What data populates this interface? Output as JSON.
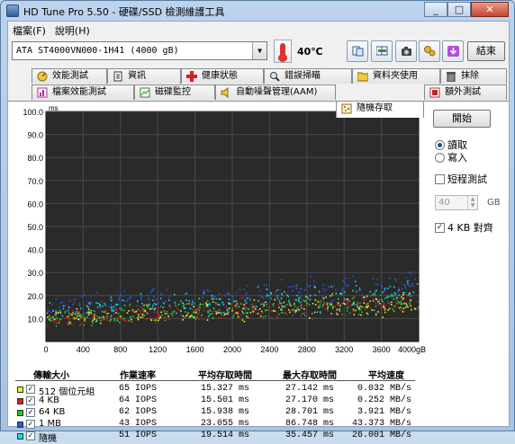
{
  "window": {
    "title": "HD Tune Pro 5.50 - 硬碟/SSD 檢測維護工具"
  },
  "menu": [
    {
      "label": "檔案(F)"
    },
    {
      "label": "說明(H)"
    }
  ],
  "toolbar": {
    "drive": "ATA   ST4000VN000-1H41 (4000 gB)",
    "temperature": "40℃",
    "exit_label": "結束"
  },
  "tabs_row1": [
    {
      "label": "效能測試",
      "icon": "gauge-icon"
    },
    {
      "label": "資訊",
      "icon": "info-icon"
    },
    {
      "label": "健康狀態",
      "icon": "health-cross-icon"
    },
    {
      "label": "錯誤掃瞄",
      "icon": "magnifier-icon"
    },
    {
      "label": "資料夾使用",
      "icon": "folder-icon"
    },
    {
      "label": "抹除",
      "icon": "trash-icon"
    }
  ],
  "tabs_row2": [
    {
      "label": "檔案效能測試",
      "icon": "file-benchmark-icon"
    },
    {
      "label": "磁碟監控",
      "icon": "monitor-icon"
    },
    {
      "label": "自動噪聲管理(AAM)",
      "icon": "speaker-icon"
    },
    {
      "label": "隨機存取",
      "icon": "random-access-icon",
      "active": true
    },
    {
      "label": "額外測試",
      "icon": "extra-tests-icon"
    }
  ],
  "side": {
    "start_label": "開始",
    "mode_read": "讀取",
    "mode_write": "寫入",
    "mode_selected": "read",
    "short_stroke_label": "短程測試",
    "short_stroke_checked": false,
    "short_stroke_value": "40",
    "short_stroke_unit": "GB",
    "align_label": "4 KB 對齊",
    "align_checked": true
  },
  "results": {
    "headers": [
      "傳輸大小",
      "作業速率",
      "平均存取時間",
      "最大存取時間",
      "平均速度"
    ],
    "rows": [
      {
        "name": "512 個位元組",
        "color": "#f5e82a",
        "iops": "65 IOPS",
        "avg": "15.327 ms",
        "max": "27.142 ms",
        "speed": "0.032 MB/s"
      },
      {
        "name": "4 KB",
        "color": "#d42020",
        "iops": "64 IOPS",
        "avg": "15.501 ms",
        "max": "27.170 ms",
        "speed": "0.252 MB/s"
      },
      {
        "name": "64 KB",
        "color": "#26c426",
        "iops": "62 IOPS",
        "avg": "15.938 ms",
        "max": "28.701 ms",
        "speed": "3.921 MB/s"
      },
      {
        "name": "1 MB",
        "color": "#2a56d8",
        "iops": "43 IOPS",
        "avg": "23.055 ms",
        "max": "86.748 ms",
        "speed": "43.373 MB/s"
      },
      {
        "name": "隨機",
        "color": "#1fd8e0",
        "iops": "51 IOPS",
        "avg": "19.514 ms",
        "max": "35.457 ms",
        "speed": "26.001 MB/s"
      }
    ]
  },
  "chart_data": {
    "type": "scatter",
    "ylabel": "ms",
    "ylim": [
      0,
      100
    ],
    "xlim": [
      0,
      4000
    ],
    "x_unit": "gB",
    "y_ticks": [
      "100.0",
      "90.0",
      "80.0",
      "70.0",
      "60.0",
      "50.0",
      "40.0",
      "30.0",
      "20.0",
      "10.0"
    ],
    "x_ticks": [
      "0",
      "400",
      "800",
      "1200",
      "1600",
      "2000",
      "2400",
      "2800",
      "3200",
      "3600",
      "4000gB"
    ],
    "grid": true,
    "background": "#2a2a2a",
    "series": [
      {
        "name": "512 個位元組",
        "color": "#f5e82a",
        "band": [
          [
            0,
            5,
            15
          ],
          [
            4000,
            9,
            25
          ]
        ]
      },
      {
        "name": "4 KB",
        "color": "#d42020",
        "band": [
          [
            0,
            5,
            15
          ],
          [
            4000,
            9,
            25
          ]
        ]
      },
      {
        "name": "64 KB",
        "color": "#26c426",
        "band": [
          [
            0,
            5,
            16
          ],
          [
            4000,
            10,
            26
          ]
        ]
      },
      {
        "name": "1 MB",
        "color": "#2a56d8",
        "band": [
          [
            0,
            10,
            22
          ],
          [
            4000,
            16,
            34
          ]
        ]
      },
      {
        "name": "隨機",
        "color": "#1fd8e0",
        "band": [
          [
            0,
            7,
            20
          ],
          [
            4000,
            12,
            30
          ]
        ]
      }
    ]
  }
}
